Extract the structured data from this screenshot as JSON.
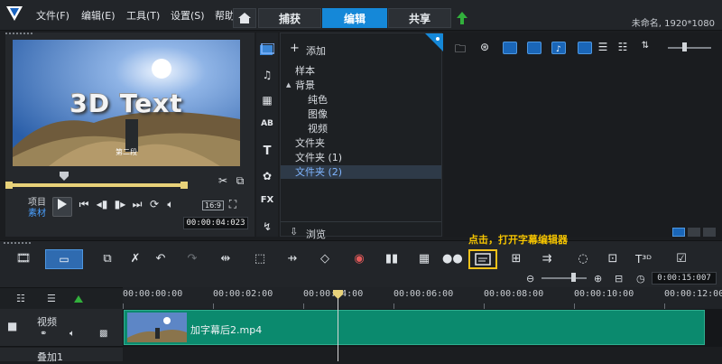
{
  "menu": [
    "文件(F)",
    "编辑(E)",
    "工具(T)",
    "设置(S)",
    "帮助"
  ],
  "tabs": {
    "capture": "捕获",
    "edit": "编辑",
    "share": "共享"
  },
  "title_info": "未命名, 1920*1080",
  "preview": {
    "text3d": "3D Text",
    "subtitle": "第二段",
    "project_label": "项目",
    "clip_label": "素材",
    "aspect": "16:9",
    "timecode": "00:00:04:023"
  },
  "library": {
    "add_label": "添加",
    "browse_label": "浏览",
    "tree": [
      {
        "label": "样本",
        "indent": 0
      },
      {
        "label": "背景",
        "indent": 0,
        "expand": "▲"
      },
      {
        "label": "纯色",
        "indent": 1
      },
      {
        "label": "图像",
        "indent": 1
      },
      {
        "label": "视频",
        "indent": 1
      },
      {
        "label": "文件夹",
        "indent": 0
      },
      {
        "label": "文件夹 (1)",
        "indent": 0
      },
      {
        "label": "文件夹 (2)",
        "indent": 0,
        "selected": true
      }
    ],
    "sidebar_fx": "FX"
  },
  "toolbar": {
    "tooltip": "点击，打开字幕编辑器",
    "timer": "0:00:15:007"
  },
  "timeline": {
    "ruler": [
      "00:00:00:00",
      "00:00:02:00",
      "00:00:04:00",
      "00:00:06:00",
      "00:00:08:00",
      "00:00:10:00",
      "00:00:12:00"
    ],
    "tracks": {
      "video": "视频",
      "overlay": "叠加1"
    },
    "clip_name": "加字幕后2.mp4"
  },
  "colors": {
    "accent": "#1588d8",
    "clip": "#0b8a6e",
    "highlight": "#f2c21a"
  }
}
